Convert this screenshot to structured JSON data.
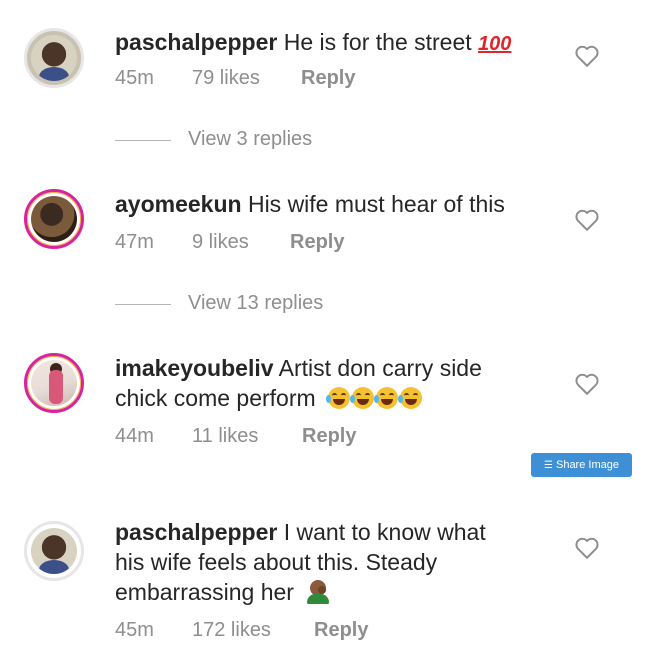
{
  "comments": [
    {
      "username": "paschalpepper",
      "lines": [
        "He is for the street"
      ],
      "emoji": "💯",
      "time": "45m",
      "likes": "79 likes",
      "reply_label": "Reply",
      "view_replies": "View 3 replies"
    },
    {
      "username": "ayomeekun",
      "lines": [
        "His wife must hear of this"
      ],
      "time": "47m",
      "likes": "9 likes",
      "reply_label": "Reply",
      "view_replies": "View 13 replies"
    },
    {
      "username": "imakeyoubeliv",
      "lines": [
        "Artist don carry side",
        "chick come perform"
      ],
      "emoji": "😂😂😂😂",
      "time": "44m",
      "likes": "11 likes",
      "reply_label": "Reply"
    },
    {
      "username": "paschalpepper",
      "lines": [
        "I want to know what",
        "his wife feels about this. Steady",
        "embarrassing her"
      ],
      "emoji": "🤦🏾‍♂️",
      "time": "45m",
      "likes": "172 likes",
      "reply_label": "Reply"
    }
  ],
  "share_image_label": "Share Image",
  "icons": {
    "like": "heart-outline-icon",
    "share": "share-icon"
  },
  "colors": {
    "meta": "#8e8e8e",
    "text": "#262626",
    "share_button": "#3d8fd6"
  }
}
